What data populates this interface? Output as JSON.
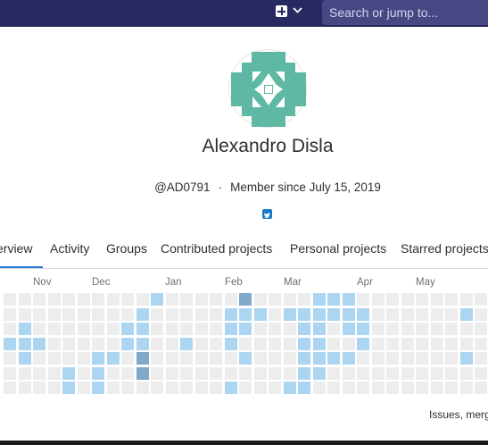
{
  "topbar": {
    "search_placeholder": "Search or jump to...",
    "new_icon": "plus-square-icon",
    "dropdown_icon": "chevron-down-icon"
  },
  "profile": {
    "name": "Alexandro Disla",
    "username": "@AD0791",
    "separator": "·",
    "member_since": "Member since July 15, 2019",
    "social_icon": "twitter-icon"
  },
  "tabs": [
    {
      "label": "erview",
      "active": true
    },
    {
      "label": "Activity",
      "active": false
    },
    {
      "label": "Groups",
      "active": false
    },
    {
      "label": "Contributed projects",
      "active": false
    },
    {
      "label": "Personal projects",
      "active": false
    },
    {
      "label": "Starred projects",
      "active": false
    }
  ],
  "calendar": {
    "months": [
      "Nov",
      "Dec",
      "Jan",
      "Feb",
      "Mar",
      "Apr",
      "May"
    ],
    "colors": {
      "0": "#ededed",
      "1": "#acd5f2",
      "2": "#7fa8c9"
    },
    "levels": [
      [
        0,
        0,
        0,
        1,
        0,
        0,
        0
      ],
      [
        0,
        0,
        1,
        1,
        1,
        0,
        0
      ],
      [
        0,
        0,
        0,
        1,
        0,
        0,
        0
      ],
      [
        0,
        0,
        0,
        0,
        0,
        0,
        0
      ],
      [
        0,
        0,
        0,
        0,
        0,
        1,
        1
      ],
      [
        0,
        0,
        0,
        0,
        0,
        0,
        0
      ],
      [
        0,
        0,
        0,
        0,
        1,
        1,
        1
      ],
      [
        0,
        0,
        0,
        0,
        1,
        0,
        0
      ],
      [
        0,
        0,
        1,
        1,
        0,
        0,
        0
      ],
      [
        0,
        1,
        1,
        1,
        2,
        2,
        0
      ],
      [
        1,
        0,
        0,
        0,
        0,
        0,
        0
      ],
      [
        0,
        0,
        0,
        0,
        0,
        0,
        0
      ],
      [
        0,
        0,
        0,
        1,
        0,
        0,
        0
      ],
      [
        0,
        0,
        0,
        0,
        0,
        0,
        0
      ],
      [
        0,
        0,
        0,
        0,
        0,
        0,
        0
      ],
      [
        0,
        1,
        1,
        1,
        0,
        0,
        1
      ],
      [
        2,
        1,
        1,
        0,
        1,
        0,
        0
      ],
      [
        0,
        1,
        0,
        0,
        0,
        0,
        0
      ],
      [
        0,
        0,
        0,
        0,
        0,
        0,
        0
      ],
      [
        0,
        1,
        0,
        0,
        0,
        0,
        1
      ],
      [
        0,
        1,
        1,
        1,
        1,
        1,
        1
      ],
      [
        1,
        1,
        1,
        1,
        1,
        1,
        0
      ],
      [
        1,
        1,
        0,
        0,
        1,
        0,
        0
      ],
      [
        1,
        1,
        1,
        0,
        1,
        0,
        0
      ],
      [
        0,
        1,
        1,
        1,
        0,
        0,
        0
      ],
      [
        0,
        0,
        0,
        0,
        0,
        0,
        0
      ],
      [
        0,
        0,
        0,
        0,
        0,
        0,
        0
      ],
      [
        0,
        0,
        0,
        0,
        0,
        0,
        0
      ],
      [
        0,
        0,
        0,
        0,
        0,
        0,
        0
      ],
      [
        0,
        0,
        0,
        0,
        0,
        0,
        0
      ],
      [
        0,
        0,
        0,
        0,
        0,
        0,
        0
      ],
      [
        0,
        1,
        0,
        0,
        1,
        0,
        0
      ],
      [
        0,
        0,
        0,
        0,
        0,
        0,
        0
      ]
    ]
  },
  "legend_text": "Issues, merg"
}
